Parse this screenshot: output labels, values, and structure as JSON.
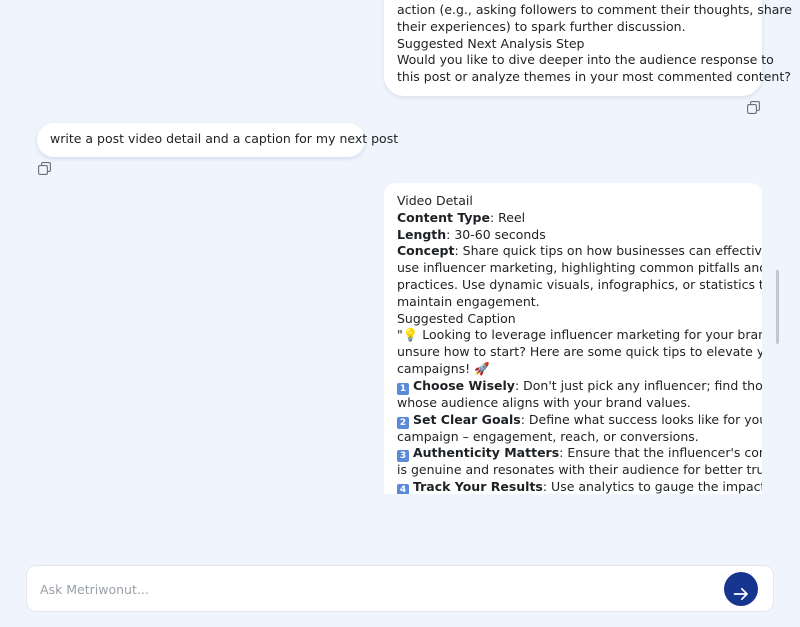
{
  "messages": {
    "ai_top": {
      "lines": [
        "action (e.g., asking followers to comment their thoughts, share",
        "their experiences) to spark further discussion.",
        "Suggested Next Analysis Step",
        "Would you like to dive deeper into the audience response to",
        "this post or analyze themes in your most commented content?"
      ]
    },
    "user": {
      "text": "write a post video detail and a caption for my next post"
    },
    "ai_main": {
      "heading": "Video Detail",
      "content_type": {
        "label": "Content Type",
        "value": ": Reel"
      },
      "length": {
        "label": "Length",
        "value": ": 30-60 seconds"
      },
      "concept": {
        "label": "Concept",
        "lines": [
          ": Share quick tips on how businesses can effectively",
          "use influencer marketing, highlighting common pitfalls and best",
          "practices. Use dynamic visuals, infographics, or statistics to",
          "maintain engagement."
        ]
      },
      "caption_heading": "Suggested Caption",
      "caption_intro": [
        "\"💡 Looking to leverage influencer marketing for your brand but",
        "unsure how to start? Here are some quick tips to elevate your",
        "campaigns! 🚀"
      ],
      "tips": [
        {
          "num": "1",
          "title": "Choose Wisely",
          "lines": [
            ": Don't just pick any influencer; find those",
            "whose audience aligns with your brand values."
          ]
        },
        {
          "num": "2",
          "title": "Set Clear Goals",
          "lines": [
            ": Define what success looks like for your",
            "campaign – engagement, reach, or conversions."
          ]
        },
        {
          "num": "3",
          "title": "Authenticity Matters",
          "lines": [
            ": Ensure that the influencer's content",
            "is genuine and resonates with their audience for better trust."
          ]
        },
        {
          "num": "4",
          "title": "Track Your Results",
          "lines": [
            ": Use analytics to gauge the impact of"
          ]
        }
      ]
    }
  },
  "composer": {
    "placeholder": "Ask Metriwonut..."
  },
  "icons": {
    "copy": "copy-icon",
    "send": "arrow-right-icon"
  },
  "colors": {
    "background": "#f0f5fd",
    "send_button": "#16358f"
  }
}
